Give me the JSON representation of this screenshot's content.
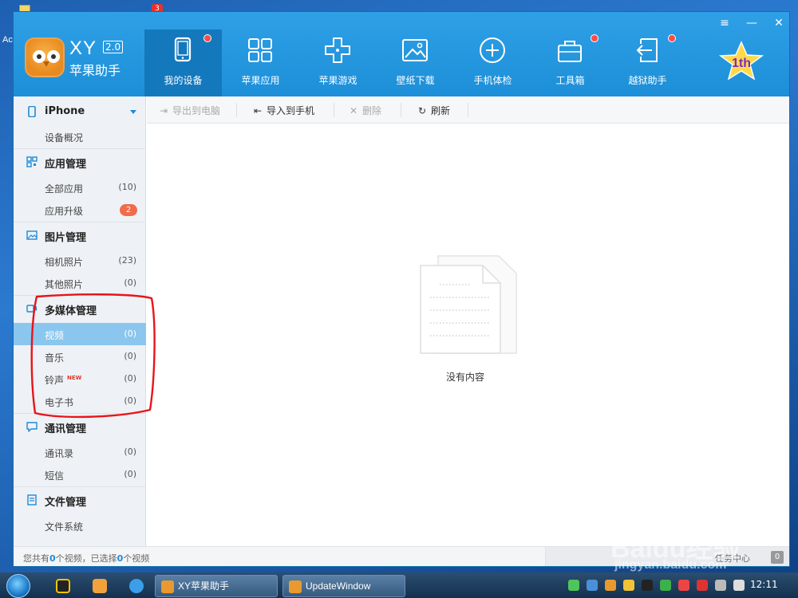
{
  "desktop": {
    "partial_label": "Ac"
  },
  "app": {
    "logo_text": "XY",
    "logo_version": "2.0",
    "logo_subtitle": "苹果助手",
    "badge_text": "1th"
  },
  "nav": [
    {
      "label": "我的设备",
      "icon": "tablet-icon",
      "dot": true,
      "active": true
    },
    {
      "label": "苹果应用",
      "icon": "apps-grid-icon",
      "dot": false,
      "active": false
    },
    {
      "label": "苹果游戏",
      "icon": "gamepad-icon",
      "dot": false,
      "active": false
    },
    {
      "label": "壁纸下载",
      "icon": "picture-icon",
      "dot": false,
      "active": false
    },
    {
      "label": "手机体检",
      "icon": "plus-circle-icon",
      "dot": false,
      "active": false
    },
    {
      "label": "工具箱",
      "icon": "toolbox-icon",
      "dot": true,
      "active": false
    },
    {
      "label": "越狱助手",
      "icon": "exit-arrow-icon",
      "dot": true,
      "active": false
    }
  ],
  "window_controls": {
    "menu": "≡",
    "minimize": "—",
    "close": "✕"
  },
  "sidebar": {
    "device": {
      "label": "iPhone",
      "overview": "设备概况"
    },
    "app_mgmt": {
      "label": "应用管理",
      "all": "全部应用",
      "all_count": "(10)",
      "upgrade": "应用升级",
      "upgrade_badge": "2"
    },
    "photo_mgmt": {
      "label": "图片管理",
      "camera": "相机照片",
      "camera_count": "(23)",
      "other": "其他照片",
      "other_count": "(0)"
    },
    "media_mgmt": {
      "label": "多媒体管理",
      "video": "视频",
      "video_count": "(0)",
      "music": "音乐",
      "music_count": "(0)",
      "ringtone": "铃声",
      "ringtone_new": "NEW",
      "ringtone_count": "(0)",
      "ebook": "电子书",
      "ebook_count": "(0)"
    },
    "comm_mgmt": {
      "label": "通讯管理",
      "contacts": "通讯录",
      "contacts_count": "(0)",
      "sms": "短信",
      "sms_count": "(0)"
    },
    "file_mgmt": {
      "label": "文件管理",
      "fs": "文件系统"
    }
  },
  "toolbar": {
    "export": "导出到电脑",
    "import": "导入到手机",
    "delete": "删除",
    "refresh": "刷新"
  },
  "content": {
    "empty_text": "没有内容"
  },
  "status": {
    "prefix": "您共有",
    "total": "0",
    "middle": "个视频，已选择",
    "selected": "0",
    "suffix": "个视频",
    "task_center": "任务中心",
    "task_count": "0"
  },
  "taskbar": {
    "window1": "XY苹果助手",
    "window2": "UpdateWindow",
    "clock": "12:11"
  },
  "watermark": {
    "main": "Baidu经验",
    "sub": "jingyan.baidu.com"
  }
}
